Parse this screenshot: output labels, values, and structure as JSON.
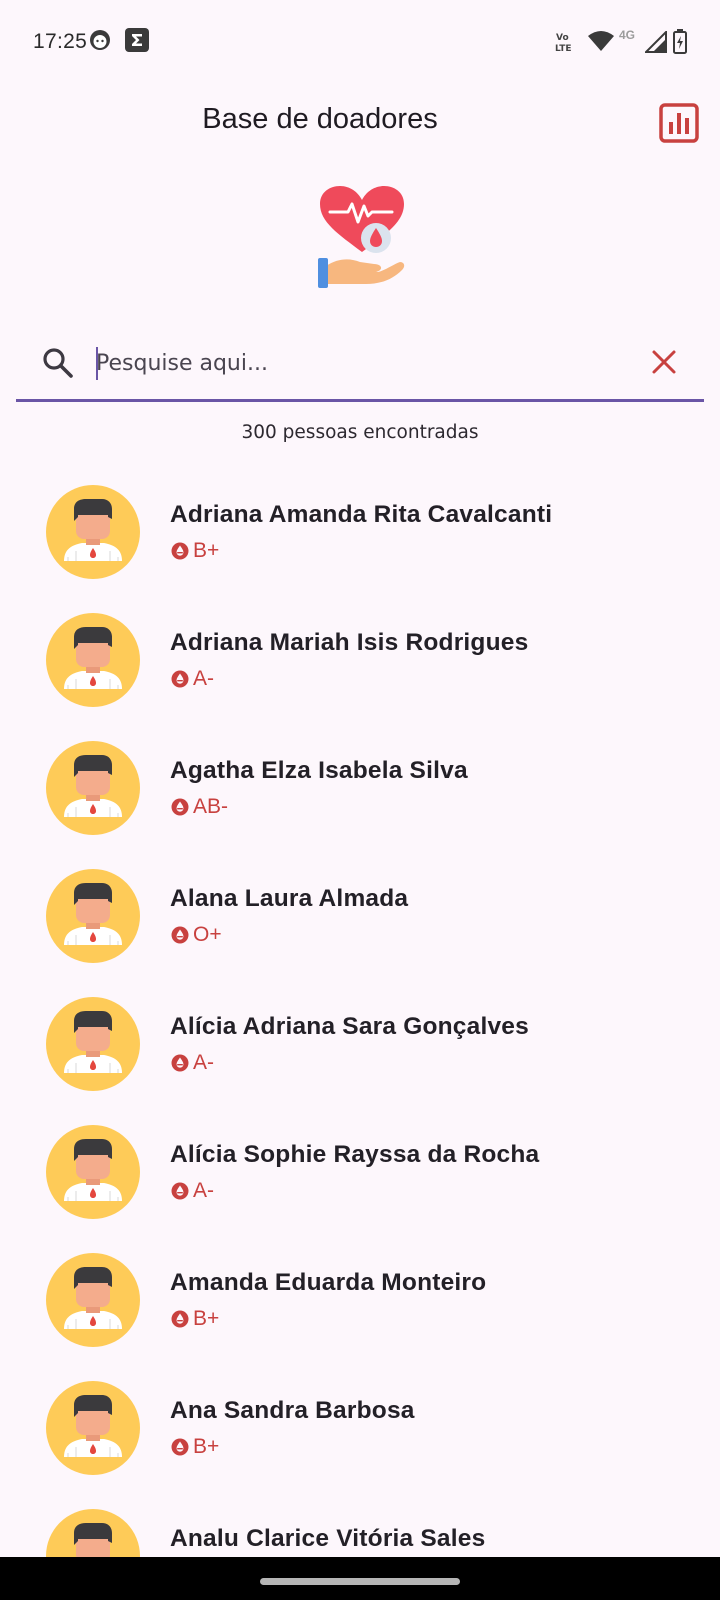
{
  "status_bar": {
    "time": "17:25",
    "network": "4G",
    "icons": [
      "face-notification-icon",
      "sigma-app-icon",
      "volte-icon",
      "wifi-icon",
      "signal-icon",
      "battery-icon"
    ]
  },
  "app_bar": {
    "title": "Base de doadores",
    "stats_icon": "bar-chart-icon"
  },
  "hero": {
    "icon": "heart-blood-donation-icon"
  },
  "search": {
    "placeholder": "Pesquise aqui...",
    "value": "",
    "search_icon": "search-icon",
    "clear_icon": "close-icon"
  },
  "results": {
    "count_text": "300 pessoas encontradas"
  },
  "donors": [
    {
      "name": "Adriana Amanda Rita Cavalcanti",
      "blood_type": "B+"
    },
    {
      "name": "Adriana Mariah Isis Rodrigues",
      "blood_type": "A-"
    },
    {
      "name": "Agatha Elza Isabela Silva",
      "blood_type": "AB-"
    },
    {
      "name": "Alana Laura Almada",
      "blood_type": "O+"
    },
    {
      "name": "Alícia Adriana Sara Gonçalves",
      "blood_type": "A-"
    },
    {
      "name": "Alícia Sophie Rayssa da Rocha",
      "blood_type": "A-"
    },
    {
      "name": "Amanda Eduarda Monteiro",
      "blood_type": "B+"
    },
    {
      "name": "Ana Sandra Barbosa",
      "blood_type": "B+"
    },
    {
      "name": "Analu Clarice Vitória Sales",
      "blood_type": ""
    }
  ],
  "colors": {
    "background": "#fdf7fc",
    "accent": "#6a55a6",
    "blood_red": "#c8413f",
    "avatar_bg": "#fecb58"
  }
}
